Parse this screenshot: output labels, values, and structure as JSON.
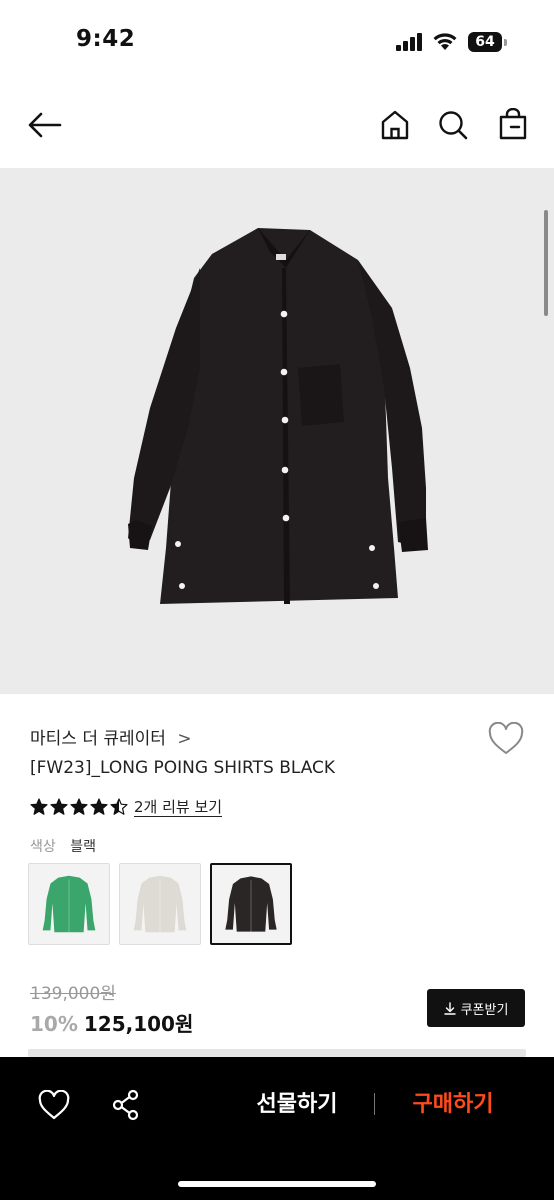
{
  "status_bar": {
    "time": "9:42",
    "battery_level": "64",
    "icons": [
      "signal-icon",
      "wifi-icon",
      "battery-icon"
    ]
  },
  "nav": {
    "icons": [
      "back-arrow-icon",
      "home-icon",
      "search-icon",
      "shopping-bag-icon"
    ]
  },
  "product": {
    "image_icon": "black-shirt-image",
    "brand": "마티스 더 큐레이터",
    "brand_chevron": ">",
    "name": "[FW23]_LONG POING SHIRTS BLACK",
    "rating": 4.5,
    "review_link": "2개 리뷰 보기",
    "color_label": "색상",
    "color_value": "블랙",
    "color_options": [
      {
        "name": "green",
        "color": "#3aa66b",
        "selected": false
      },
      {
        "name": "light-gray",
        "color": "#dedbd4",
        "selected": false
      },
      {
        "name": "black",
        "color": "#2a2626",
        "selected": true
      }
    ],
    "original_price": "139,000원",
    "discount": "10%",
    "sale_price": "125,100원",
    "coupon_label": "쿠폰받기"
  },
  "bottom_bar": {
    "gift_label": "선물하기",
    "buy_label": "구매하기",
    "buy_color": "#ff4a1c",
    "icons": [
      "heart-icon",
      "share-icon"
    ]
  }
}
